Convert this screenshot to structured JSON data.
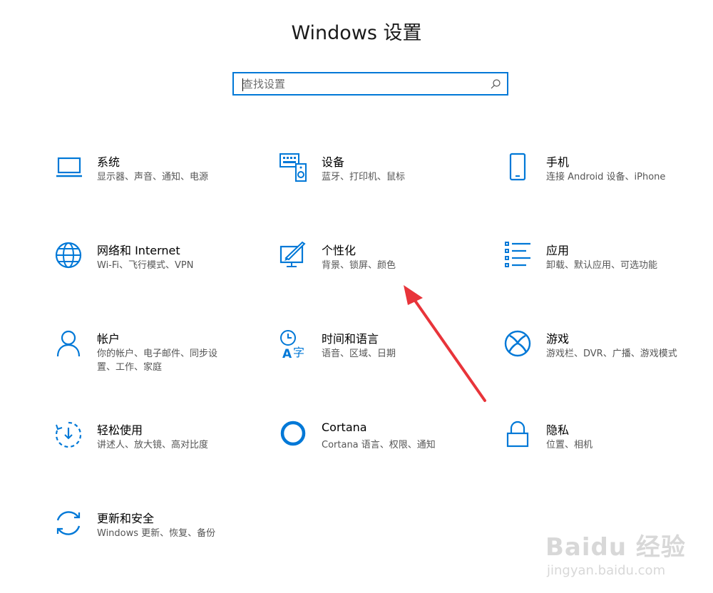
{
  "window": {
    "title": "Windows 设置"
  },
  "search": {
    "placeholder": "查找设置",
    "icon": "search-icon"
  },
  "accent_color": "#0078d7",
  "tiles": [
    {
      "name": "系统",
      "desc": "显示器、声音、通知、电源",
      "icon": "laptop-icon"
    },
    {
      "name": "设备",
      "desc": "蓝牙、打印机、鼠标",
      "icon": "keyboard-speaker-icon"
    },
    {
      "name": "手机",
      "desc": "连接 Android 设备、iPhone",
      "icon": "phone-icon"
    },
    {
      "name": "网络和 Internet",
      "desc": "Wi-Fi、飞行模式、VPN",
      "icon": "globe-icon"
    },
    {
      "name": "个性化",
      "desc": "背景、锁屏、颜色",
      "icon": "paint-monitor-icon"
    },
    {
      "name": "应用",
      "desc": "卸载、默认应用、可选功能",
      "icon": "app-list-icon"
    },
    {
      "name": "帐户",
      "desc": "你的帐户、电子邮件、同步设置、工作、家庭",
      "icon": "person-icon"
    },
    {
      "name": "时间和语言",
      "desc": "语音、区域、日期",
      "icon": "time-language-icon"
    },
    {
      "name": "游戏",
      "desc": "游戏栏、DVR、广播、游戏模式",
      "icon": "xbox-icon"
    },
    {
      "name": "轻松使用",
      "desc": "讲述人、放大镜、高对比度",
      "icon": "ease-of-access-icon"
    },
    {
      "name": "Cortana",
      "desc": "Cortana 语言、权限、通知",
      "icon": "cortana-ring-icon"
    },
    {
      "name": "隐私",
      "desc": "位置、相机",
      "icon": "lock-icon"
    },
    {
      "name": "更新和安全",
      "desc": "Windows 更新、恢复、备份",
      "icon": "sync-icon"
    }
  ],
  "annotation": {
    "arrow_color": "#e8343a"
  },
  "watermark": {
    "brand": "Baidu 经验",
    "url": "jingyan.baidu.com"
  }
}
